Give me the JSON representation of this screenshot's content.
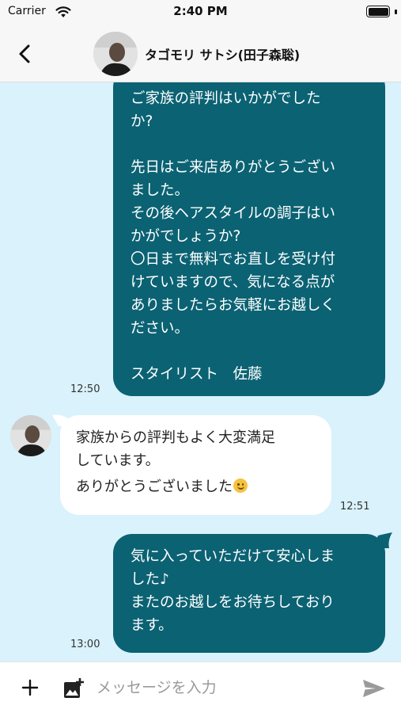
{
  "status_bar": {
    "carrier": "Carrier",
    "time": "2:40 PM"
  },
  "header": {
    "back_icon": "chevron-left-icon",
    "contact_name": "タゴモリ サトシ(田子森聡)"
  },
  "messages": [
    {
      "direction": "outgoing",
      "lines": [
        "ご家族の評判はいかがでした",
        "か?",
        "",
        "先日はご来店ありがとうござい",
        "ました。",
        "その後ヘアスタイルの調子はい",
        "かがでしょうか?",
        "〇日まで無料でお直しを受け付",
        "けていますので、気になる点が",
        "ありましたらお気軽にお越しく",
        "ださい。",
        "",
        "スタイリスト　佐藤"
      ],
      "time": "12:50"
    },
    {
      "direction": "incoming",
      "lines": [
        "家族からの評判もよく大変満足",
        "しています。",
        "ありがとうございました"
      ],
      "emoji": "smiling-face-icon",
      "time": "12:51"
    },
    {
      "direction": "outgoing",
      "lines": [
        "気に入っていただけて安心しま",
        "した♪",
        "またのお越しをお待ちしており",
        "ます。"
      ],
      "time": "13:00"
    }
  ],
  "input_bar": {
    "placeholder": "メッセージを入力",
    "value": ""
  },
  "colors": {
    "chat_background": "#d9f2fb",
    "outgoing_bubble": "#0b6273",
    "incoming_bubble": "#ffffff",
    "header_background": "#f7f7f7"
  }
}
